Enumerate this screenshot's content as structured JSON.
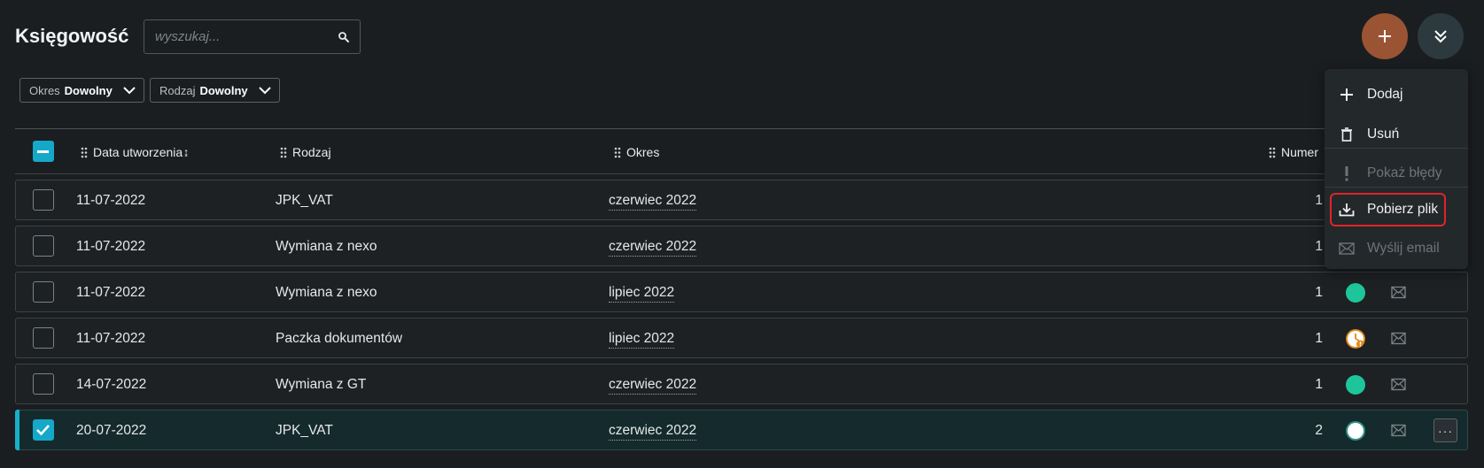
{
  "app": {
    "title": "Księgowość"
  },
  "search": {
    "placeholder": "wyszukaj..."
  },
  "filters": [
    {
      "label": "Okres",
      "value": "Dowolny"
    },
    {
      "label": "Rodzaj",
      "value": "Dowolny"
    }
  ],
  "fab": {
    "add_icon": "plus-icon",
    "menu_icon": "double-chevron-down-icon",
    "add_color": "#9a5434"
  },
  "table": {
    "columns": [
      "Data utworzenia",
      "Rodzaj",
      "Okres",
      "Numer"
    ],
    "sort_indicator": "↨",
    "rows": [
      {
        "date": "11-07-2022",
        "type": "JPK_VAT",
        "period": "czerwiec 2022",
        "number": "1",
        "status": "hidden",
        "selected": false
      },
      {
        "date": "11-07-2022",
        "type": "Wymiana z nexo",
        "period": "czerwiec 2022",
        "number": "1",
        "status": "hidden",
        "selected": false
      },
      {
        "date": "11-07-2022",
        "type": "Wymiana z nexo",
        "period": "lipiec 2022",
        "number": "1",
        "status": "success",
        "selected": false
      },
      {
        "date": "11-07-2022",
        "type": "Paczka dokumentów",
        "period": "lipiec 2022",
        "number": "1",
        "status": "pending-warning",
        "selected": false
      },
      {
        "date": "14-07-2022",
        "type": "Wymiana z GT",
        "period": "czerwiec 2022",
        "number": "1",
        "status": "success",
        "selected": false
      },
      {
        "date": "20-07-2022",
        "type": "JPK_VAT",
        "period": "czerwiec 2022",
        "number": "2",
        "status": "new",
        "selected": true
      }
    ],
    "more_label": "···"
  },
  "menu": {
    "items": [
      {
        "label": "Dodaj",
        "icon": "plus-icon",
        "disabled": false
      },
      {
        "label": "Usuń",
        "icon": "trash-icon",
        "disabled": false
      },
      {
        "label": "Pokaż błędy",
        "icon": "exclamation-icon",
        "disabled": true
      },
      {
        "label": "Pobierz plik",
        "icon": "download-icon",
        "disabled": false,
        "highlighted": true
      },
      {
        "label": "Wyślij email",
        "icon": "mail-icon",
        "disabled": true
      }
    ]
  },
  "colors": {
    "accent": "#16a8c8",
    "status_success": "#1fc59a",
    "status_new": "#ffffff",
    "status_warning": "#e08a1e",
    "highlight_border": "#e0242b"
  }
}
